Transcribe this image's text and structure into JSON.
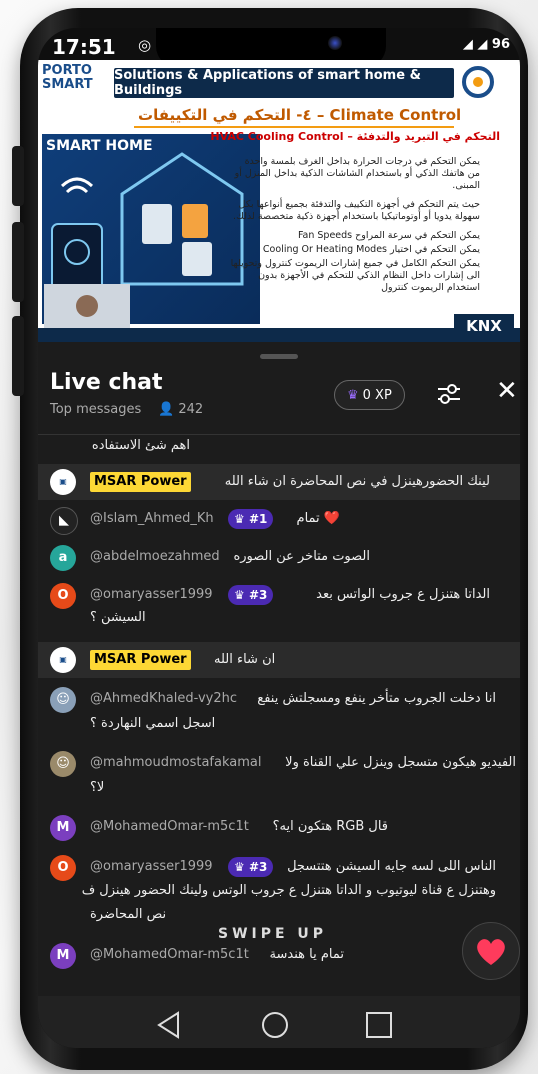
{
  "status": {
    "time": "17:51",
    "battery": "96"
  },
  "video": {
    "title": "Solutions & Applications of smart home & Buildings",
    "logo_text": "PORTO SMART",
    "slide_heading": "٤- التحكم في التكييفات – Climate Control",
    "smart_home_label": "SMART HOME",
    "hvac_label": "HVAC Cooling Control – التحكم في التبريد والتدفئة",
    "paragraphs": [
      "يمكن التحكم في درجات الحرارة بداخل الغرف بلمسة واحدة من هاتفك الذكي أو باستخدام الشاشات الذكية بداخل المنزل أو المبنى.",
      "حيث يتم التحكم في أجهزة التكييف والتدفئة بجميع أنواعها بكل سهولة يدويا أو أوتوماتيكيا باستخدام أجهزة ذكية متخصصة لذلك.",
      "يمكن التحكم في سرعة المراوح Fan Speeds",
      "يمكن التحكم في اختيار Cooling Or Heating Modes",
      "يمكن التحكم الكامل في جميع إشارات الريموت كنترول وتحويلها الى إشارات داخل النظام الذكي للتحكم في الأجهزة بدون استخدام الريموت كنترول"
    ],
    "knx_label": "KNX"
  },
  "chat": {
    "title": "Live chat",
    "mode": "Top messages",
    "viewers": "242",
    "xp": "0 XP",
    "swipe_hint": "SWIPE UP",
    "messages": [
      {
        "text": "اهم شئ الاستفاده"
      },
      {
        "author": "MSAR Power",
        "owner": true,
        "text": "لينك الحضورهينزل في نص المحاضرة ان شاء الله"
      },
      {
        "author": "@Islam_Ahmed_Kh",
        "badge": "#1",
        "text": "تمام ❤️"
      },
      {
        "author": "@abdelmoezahmed",
        "avatar_letter": "a",
        "avatar_color": "#26a69a",
        "text": "الصوت متاخر عن الصوره"
      },
      {
        "author": "@omaryasser1999",
        "badge": "#3",
        "avatar_letter": "O",
        "avatar_color": "#e64a19",
        "text": "الداتا هتنزل ع جروب الواتس بعد",
        "text2": "السيشن ؟"
      },
      {
        "author": "MSAR Power",
        "owner": true,
        "text": "ان شاء الله"
      },
      {
        "author": "@AhmedKhaled-vy2hc",
        "text": "انا دخلت الجروب متأخر ينفع ومسجلتش ينفع",
        "text2": "اسجل اسمي النهاردة ؟"
      },
      {
        "author": "@mahmoudmostafakamal",
        "text": "الفيديو هيكون متسجل وينزل علي القناة ولا",
        "text2": "لا؟"
      },
      {
        "author": "@MohamedOmar-m5c1t",
        "avatar_letter": "M",
        "avatar_color": "#7b3fbf",
        "text": "هتكون ايه؟ RGB قال"
      },
      {
        "author": "@omaryasser1999",
        "badge": "#3",
        "avatar_letter": "O",
        "avatar_color": "#e64a19",
        "text": "الناس اللى لسه جايه السيشن هتتسجل",
        "text2": "وهتنزل ع قناة ليوتيوب و الداتا هتنزل ع جروب الوتس ولينك الحضور هينزل ف",
        "text3": "نص المحاضرة"
      },
      {
        "author": "@MohamedOmar-m5c1t",
        "avatar_letter": "M",
        "avatar_color": "#7b3fbf",
        "text": "تمام يا هندسة"
      }
    ]
  },
  "colors": {
    "owner_badge": "#fdd835",
    "member_badge": "#4b2ab3",
    "like": "#ff3b5c"
  }
}
